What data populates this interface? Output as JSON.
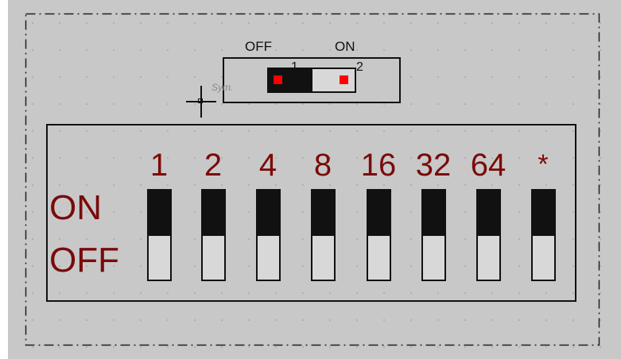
{
  "toggle": {
    "off_label": "OFF",
    "on_label": "ON",
    "pin1": "1",
    "pin2": "2",
    "sym_label": "Sym."
  },
  "dip": {
    "on_label": "ON",
    "off_label": "OFF",
    "switches": [
      {
        "label": "1",
        "state": "on"
      },
      {
        "label": "2",
        "state": "on"
      },
      {
        "label": "4",
        "state": "on"
      },
      {
        "label": "8",
        "state": "on"
      },
      {
        "label": "16",
        "state": "on"
      },
      {
        "label": "32",
        "state": "on"
      },
      {
        "label": "64",
        "state": "on"
      },
      {
        "label": "*",
        "state": "on"
      }
    ]
  },
  "colors": {
    "canvas": "#c8c8c8",
    "label_red": "#7a0a0a",
    "pin_red": "#ff0000",
    "lever": "#111111"
  }
}
